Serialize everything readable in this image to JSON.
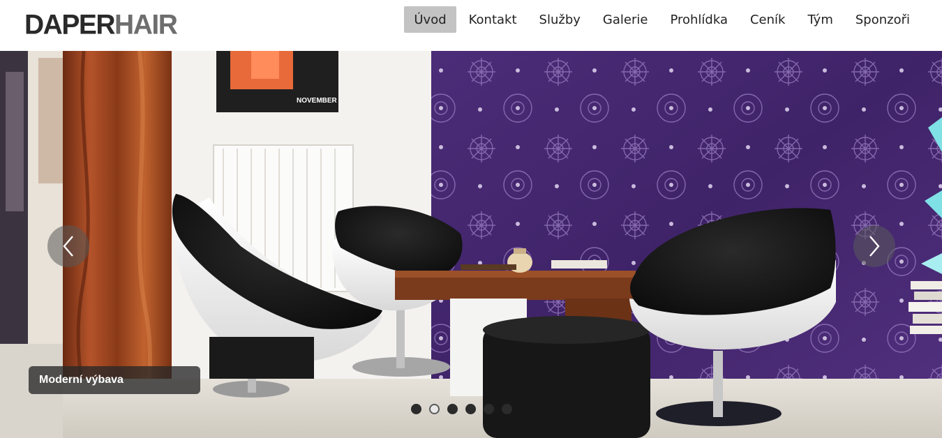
{
  "brand": {
    "part1": "DAPER",
    "part2": "HAIR"
  },
  "nav": {
    "items": [
      {
        "label": "Úvod",
        "active": true
      },
      {
        "label": "Kontakt"
      },
      {
        "label": "Služby"
      },
      {
        "label": "Galerie"
      },
      {
        "label": "Prohlídka"
      },
      {
        "label": "Ceník"
      },
      {
        "label": "Tým"
      },
      {
        "label": "Sponzoři"
      }
    ]
  },
  "slider": {
    "caption": "Moderní výbava",
    "poster_text": "NOVEMBER",
    "slide_count": 6,
    "active_index": 1,
    "prev_icon": "chevron-left-icon",
    "next_icon": "chevron-right-icon"
  },
  "colors": {
    "active_nav_bg": "#c3c3c3",
    "wallpaper": "#4a2b73"
  }
}
